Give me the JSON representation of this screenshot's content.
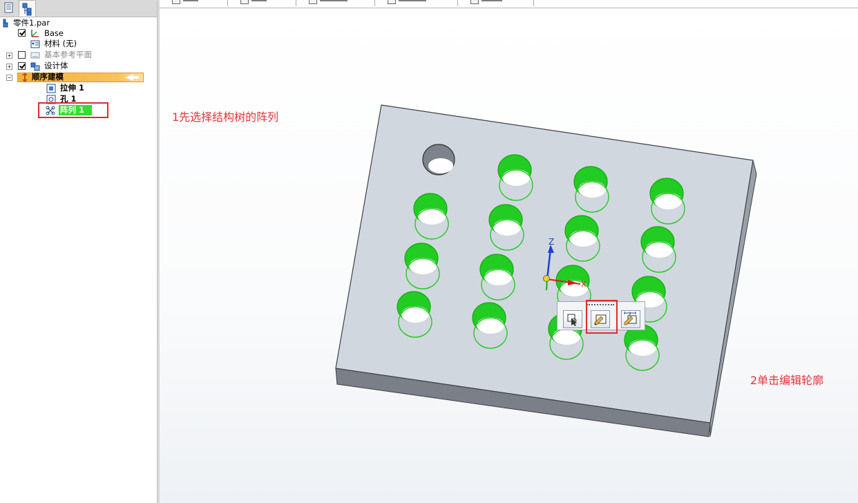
{
  "tree": {
    "root_label": "零件1.par",
    "base_label": "Base",
    "material_label": "材料 (无)",
    "ref_planes_label": "基本参考平面",
    "design_body_label": "设计体",
    "ordered_label": "顺序建模",
    "extrude_label": "拉伸 1",
    "hole_label": "孔 1",
    "pattern_label": "阵列 1"
  },
  "annotations": {
    "step1": "1先选择结构树的阵列",
    "step2": "2单击编辑轮廓"
  },
  "triad": {
    "z_label": "Z",
    "x_label": "X"
  },
  "colors": {
    "hole_green": "#22cc22",
    "plate_top": "#d1d7de",
    "plate_front": "#7a7f88",
    "highlight_red": "#e02a2a",
    "ordered_bar": "#f5b13a",
    "pattern_highlight": "#33dd33"
  },
  "icons": {
    "panel_tab_1": "feature-tree-icon",
    "panel_tab_2": "layers-icon",
    "toolbar_1": "select-sketch-icon",
    "toolbar_2": "edit-profile-icon",
    "toolbar_3": "dynamic-edit-icon"
  }
}
